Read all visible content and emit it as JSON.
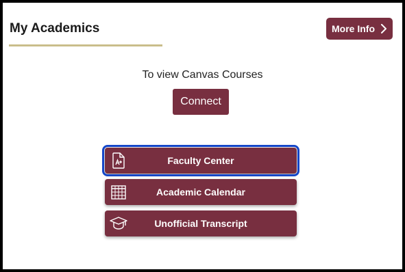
{
  "header": {
    "title": "My Academics",
    "more_info_label": "More Info"
  },
  "canvas": {
    "prompt": "To view Canvas Courses",
    "connect_label": "Connect"
  },
  "links": [
    {
      "label": "Faculty Center",
      "icon": "document-grade-icon",
      "focused": true
    },
    {
      "label": "Academic Calendar",
      "icon": "calendar-icon",
      "focused": false
    },
    {
      "label": "Unofficial Transcript",
      "icon": "graduation-cap-icon",
      "focused": false
    }
  ],
  "colors": {
    "brand_garnet": "#782f40",
    "gold_underline": "#c9bd8a",
    "focus_ring": "#1446c8",
    "border": "#000000"
  }
}
